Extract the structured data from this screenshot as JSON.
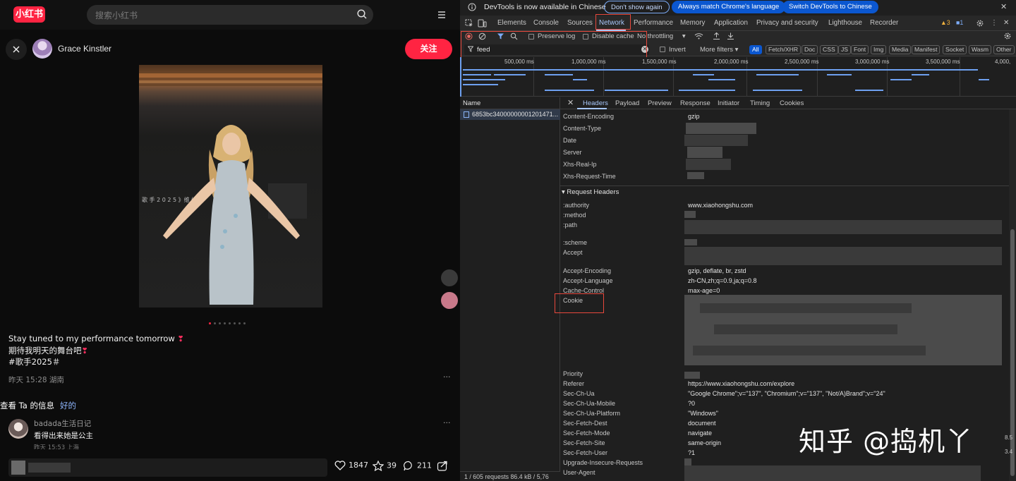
{
  "xhs": {
    "logo": "小红书",
    "search_placeholder": "搜索小红书",
    "author_name": "Grace Kinstler",
    "follow_label": "关注",
    "post_lines": [
      "Stay tuned to my performance tomorrow",
      "期待我明天的舞台吧",
      "#歌手2025＃"
    ],
    "post_meta": "昨天 15:28 湖南",
    "photo_text": "歌 手 2 0 2 5 》维 续",
    "banner_text": "查看 Ta 的信息",
    "banner_ok": "好的",
    "comment": {
      "user": "badada生活日记",
      "text": "看得出来她是公主",
      "time": "昨天 15:53 上海"
    },
    "more_glyph": "···",
    "stats": {
      "likes": "1847",
      "collects": "39",
      "comments": "211"
    },
    "image_count": 8,
    "active_image_index": 0
  },
  "devtools": {
    "notice_text": "DevTools is now available in Chinese",
    "notice_buttons": [
      "Don't show again",
      "Always match Chrome's language",
      "Switch DevTools to Chinese"
    ],
    "tabs": [
      "Elements",
      "Console",
      "Sources",
      "Network",
      "Performance",
      "Memory",
      "Application",
      "Privacy and security",
      "Lighthouse",
      "Recorder"
    ],
    "active_tab": "Network",
    "warn_count": "3",
    "msg_count": "1",
    "toolbar": {
      "preserve_log": "Preserve log",
      "disable_cache": "Disable cache",
      "throttling": "No throttling"
    },
    "filter": {
      "value": "feed",
      "invert": "Invert",
      "more_filters": "More filters",
      "types": [
        "All",
        "Fetch/XHR",
        "Doc",
        "CSS",
        "JS",
        "Font",
        "Img",
        "Media",
        "Manifest",
        "Socket",
        "Wasm",
        "Other"
      ]
    },
    "timeline_ticks": [
      "500,000 ms",
      "1,000,000 ms",
      "1,500,000 ms",
      "2,000,000 ms",
      "2,500,000 ms",
      "3,000,000 ms",
      "3,500,000 ms",
      "4,000,"
    ],
    "list_header": "Name",
    "request_name": "6853bc34000000001201471...",
    "status": "1 / 605 requests   86.4 kB / 5,76",
    "detail_tabs": [
      "Headers",
      "Payload",
      "Preview",
      "Response",
      "Initiator",
      "Timing",
      "Cookies"
    ],
    "response_headers": [
      {
        "name": "Content-Encoding",
        "value": "gzip"
      },
      {
        "name": "Content-Type",
        "value": ""
      },
      {
        "name": "Date",
        "value": ""
      },
      {
        "name": "Server",
        "value": ""
      },
      {
        "name": "Xhs-Real-Ip",
        "value": ""
      },
      {
        "name": "Xhs-Request-Time",
        "value": ""
      }
    ],
    "request_section": "▾ Request Headers",
    "request_headers": [
      {
        "name": ":authority",
        "value": "www.xiaohongshu.com"
      },
      {
        "name": ":method",
        "value": ""
      },
      {
        "name": ":path",
        "value": ""
      },
      {
        "name": ":scheme",
        "value": ""
      },
      {
        "name": "Accept",
        "value": ""
      },
      {
        "name": "Accept-Encoding",
        "value": "gzip, deflate, br, zstd"
      },
      {
        "name": "Accept-Language",
        "value": "zh-CN,zh;q=0.9,ja;q=0.8"
      },
      {
        "name": "Cache-Control",
        "value": "max-age=0"
      },
      {
        "name": "Cookie",
        "value": ""
      },
      {
        "name": "Priority",
        "value": ""
      },
      {
        "name": "Referer",
        "value": "https://www.xiaohongshu.com/explore"
      },
      {
        "name": "Sec-Ch-Ua",
        "value": "\"Google Chrome\";v=\"137\", \"Chromium\";v=\"137\", \"Not/A)Brand\";v=\"24\""
      },
      {
        "name": "Sec-Ch-Ua-Mobile",
        "value": "?0"
      },
      {
        "name": "Sec-Ch-Ua-Platform",
        "value": "\"Windows\""
      },
      {
        "name": "Sec-Fetch-Dest",
        "value": "document"
      },
      {
        "name": "Sec-Fetch-Mode",
        "value": "navigate"
      },
      {
        "name": "Sec-Fetch-Site",
        "value": "same-origin"
      },
      {
        "name": "Sec-Fetch-User",
        "value": "?1"
      },
      {
        "name": "Upgrade-Insecure-Requests",
        "value": ""
      },
      {
        "name": "User-Agent",
        "value": ""
      }
    ],
    "side_numbers": [
      "8.5",
      "3.4"
    ]
  },
  "watermark": "知乎 @捣机丫",
  "colors": {
    "brand": "#ff2442",
    "devtools_accent": "#a8c7fa",
    "highlight": "#e8483c"
  }
}
